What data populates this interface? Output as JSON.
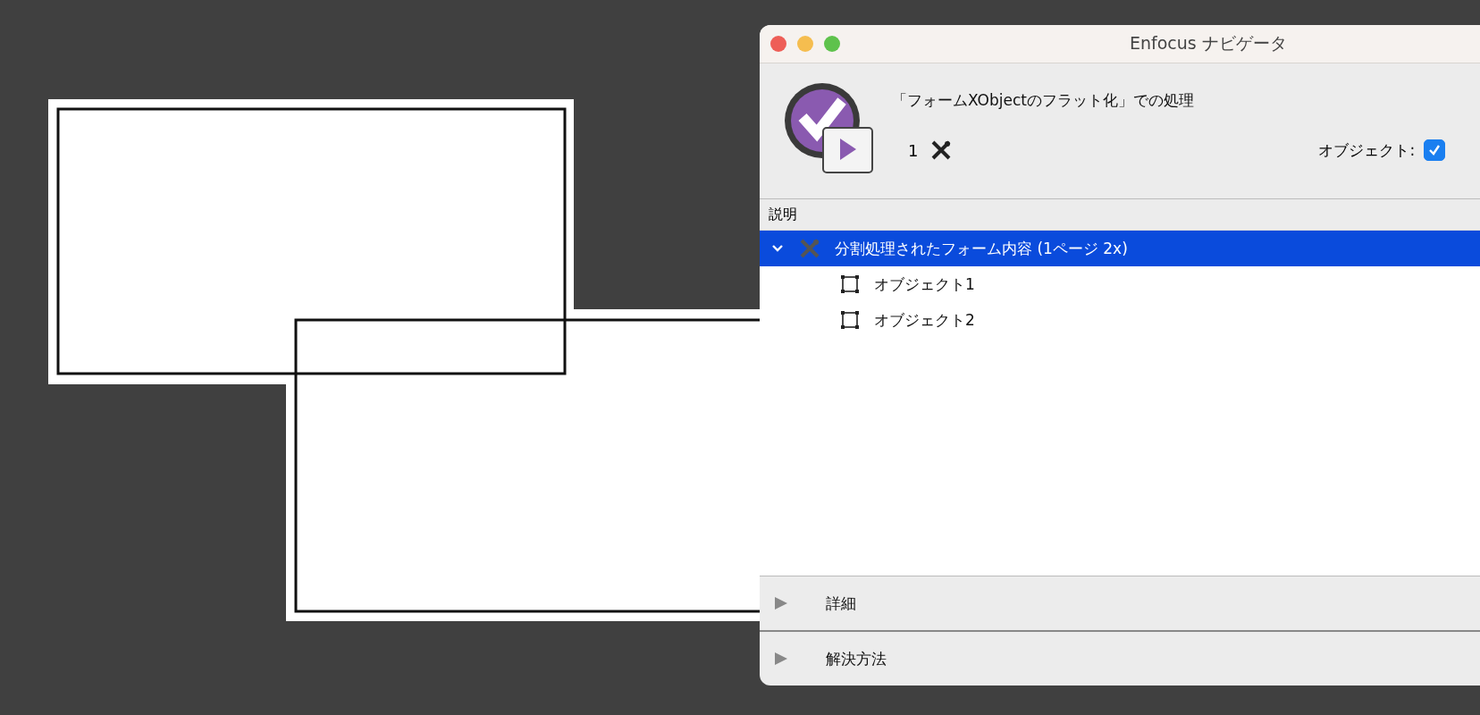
{
  "window": {
    "title": "Enfocus ナビゲータ"
  },
  "header": {
    "heading": "「フォームXObjectのフラット化」での処理",
    "count": "1",
    "object_label": "オブジェクト:",
    "object_checked": true
  },
  "list": {
    "column": "説明",
    "items": [
      {
        "label": "分割処理されたフォーム内容 (1ページ 2x)",
        "kind": "fix",
        "selected": true,
        "expanded": true,
        "children": [
          {
            "label": "オブジェクト1",
            "kind": "object",
            "selected": false
          },
          {
            "label": "オブジェクト2",
            "kind": "object",
            "selected": false
          }
        ]
      }
    ]
  },
  "sections": [
    {
      "label": "詳細",
      "expanded": false
    },
    {
      "label": "解決方法",
      "expanded": false
    }
  ]
}
